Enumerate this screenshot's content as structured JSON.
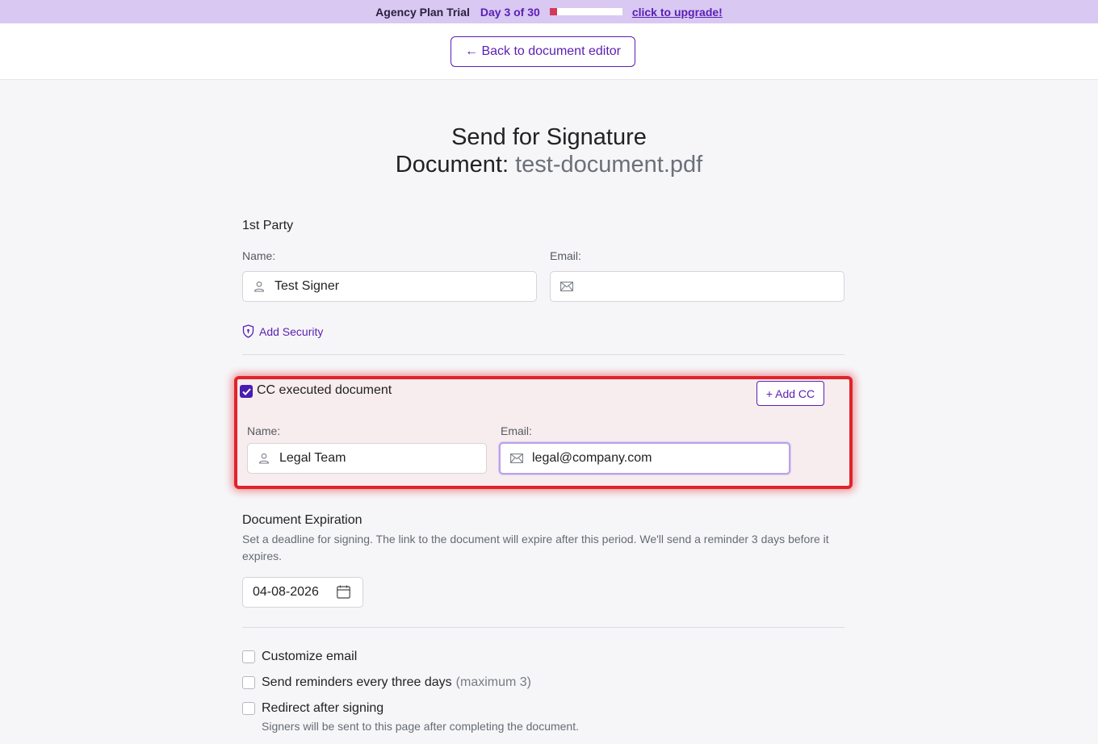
{
  "trial_bar": {
    "plan_label": "Agency Plan Trial",
    "day_label": "Day 3 of 30",
    "progress_fraction": 0.1,
    "upgrade_link": "click to upgrade!"
  },
  "header": {
    "back_button": "← Back to document editor"
  },
  "title": {
    "heading": "Send for Signature",
    "doc_prefix": "Document:",
    "doc_name": "test-document.pdf"
  },
  "party": {
    "section_label": "1st Party",
    "name_label": "Name:",
    "name_value": "Test Signer",
    "email_label": "Email:",
    "email_value": "",
    "security_link": "Add Security"
  },
  "cc": {
    "checkbox_label": "CC executed document",
    "checked": true,
    "add_cc_button": "+ Add CC",
    "name_label": "Name:",
    "name_value": "Legal Team",
    "email_label": "Email:",
    "email_value": "legal@company.com"
  },
  "expiration": {
    "section_label": "Document Expiration",
    "description": "Set a deadline for signing. The link to the document will expire after this period. We'll send a reminder 3 days before it expires.",
    "date_value": "04-08-2026"
  },
  "options": [
    {
      "label": "Customize email",
      "suffix": "",
      "checked": false
    },
    {
      "label": "Send reminders every three days",
      "suffix": "(maximum 3)",
      "checked": false
    },
    {
      "label": "Redirect after signing",
      "suffix": "",
      "checked": false,
      "note": "Signers will be sent to this page after completing the document."
    }
  ],
  "colors": {
    "accent": "#5a1fb3",
    "trial_bar_bg": "#d9c8f2",
    "highlight_border": "#e0242a",
    "progress_fill": "#d23a5a"
  },
  "icons": {
    "name": "user-icon",
    "email": "envelope-icon",
    "security": "shield-icon",
    "date": "calendar-icon",
    "check": "checkmark-icon"
  }
}
